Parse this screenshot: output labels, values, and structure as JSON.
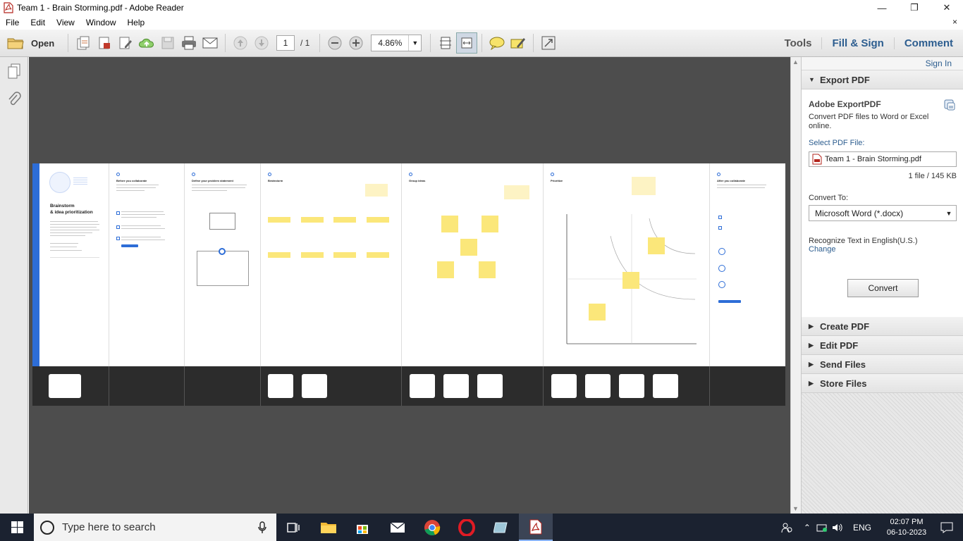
{
  "window": {
    "title": "Team 1 - Brain Storming.pdf - Adobe Reader",
    "minimize": "—",
    "maximize": "❐",
    "close": "✕"
  },
  "menu": {
    "items": [
      "File",
      "Edit",
      "View",
      "Window",
      "Help"
    ],
    "close_doc": "×"
  },
  "toolbar": {
    "open_label": "Open",
    "page_current": "1",
    "page_total": "/ 1",
    "zoom": "4.86%",
    "tools": "Tools",
    "fill_sign": "Fill & Sign",
    "comment": "Comment"
  },
  "document": {
    "page_bg": "#ffffff",
    "accent": "#2d6dd7",
    "sticky_color": "#fbe77a",
    "intro_title_1": "Brainstorm",
    "intro_title_2": "& idea prioritization",
    "sections": [
      "Before you collaborate",
      "Define your problem statement",
      "Brainstorm",
      "Group ideas",
      "Prioritize",
      "After you collaborate"
    ]
  },
  "export_pane": {
    "sign_in": "Sign In",
    "export_pdf": "Export PDF",
    "adobe_exportpdf": "Adobe ExportPDF",
    "description": "Convert PDF files to Word or Excel online.",
    "select_file_label": "Select PDF File:",
    "file_name": "Team 1 - Brain Storming.pdf",
    "file_info": "1 file / 145 KB",
    "convert_to_label": "Convert To:",
    "convert_to_value": "Microsoft Word (*.docx)",
    "recognize": "Recognize Text in English(U.S.)",
    "change": "Change",
    "convert_button": "Convert",
    "create_pdf": "Create PDF",
    "edit_pdf": "Edit PDF",
    "send_files": "Send Files",
    "store_files": "Store Files"
  },
  "taskbar": {
    "search_placeholder": "Type here to search",
    "language": "ENG",
    "time": "02:07 PM",
    "date": "06-10-2023"
  }
}
